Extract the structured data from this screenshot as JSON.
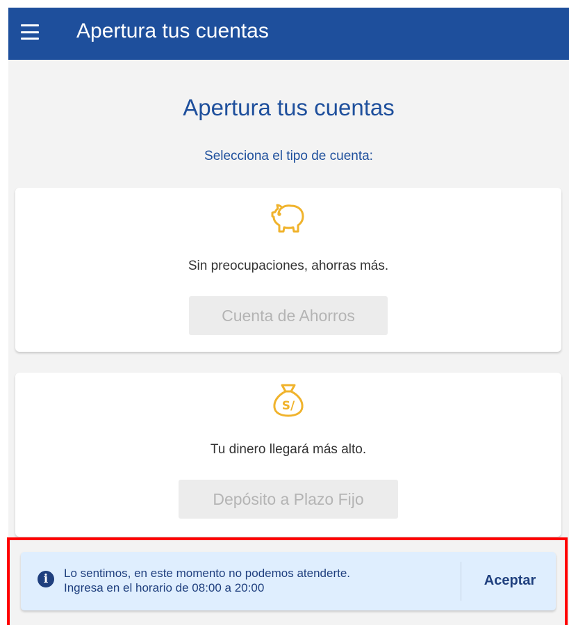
{
  "app_bar": {
    "title": "Apertura tus cuentas",
    "menu_icon": "hamburger-menu-icon",
    "color": "#1e4f9c"
  },
  "main": {
    "title": "Apertura tus cuentas",
    "subtitle": "Selecciona el tipo de cuenta:",
    "cards": [
      {
        "icon": "piggy-bank-icon",
        "description": "Sin preocupaciones, ahorras más.",
        "button_label": "Cuenta de Ahorros",
        "button_state": "disabled"
      },
      {
        "icon": "money-bag-icon",
        "description": "Tu dinero llegará más alto.",
        "button_label": "Depósito a Plazo Fijo",
        "button_state": "disabled"
      }
    ],
    "icon_color": "#f0b32c"
  },
  "notice": {
    "icon": "info-icon",
    "icon_glyph": "i",
    "line1": "Lo sentimos, en este momento no podemos atenderte.",
    "line2": "Ingresa en el horario de 08:00 a 20:00",
    "action_label": "Aceptar",
    "background": "#dfeefe",
    "highlight_color": "#ff0000"
  }
}
